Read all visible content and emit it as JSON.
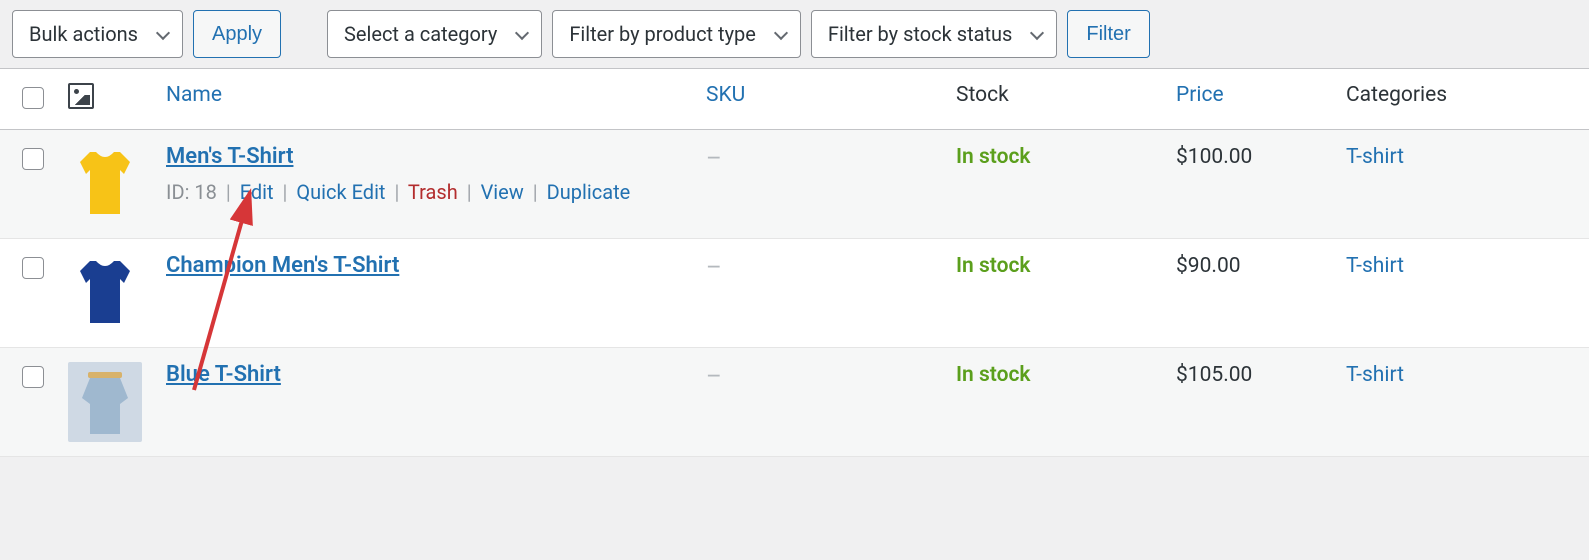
{
  "toolbar": {
    "bulk_label": "Bulk actions",
    "apply_label": "Apply",
    "category_label": "Select a category",
    "type_label": "Filter by product type",
    "stock_label": "Filter by stock status",
    "filter_label": "Filter"
  },
  "columns": {
    "name": "Name",
    "sku": "SKU",
    "stock": "Stock",
    "price": "Price",
    "categories": "Categories"
  },
  "products": [
    {
      "id_label": "ID: 18",
      "title": "Men's T-Shirt",
      "sku": "–",
      "stock": "In stock",
      "price": "$100.00",
      "category": "T-shirt",
      "show_row_actions": true,
      "thumb_color": "#f7c317",
      "thumb_type": "tshirt"
    },
    {
      "title": "Champion Men's T-Shirt",
      "sku": "–",
      "stock": "In stock",
      "price": "$90.00",
      "category": "T-shirt",
      "show_row_actions": false,
      "thumb_color": "#1a3e91",
      "thumb_type": "tshirt"
    },
    {
      "title": "Blue T-Shirt",
      "sku": "–",
      "stock": "In stock",
      "price": "$105.00",
      "category": "T-shirt",
      "show_row_actions": false,
      "thumb_color": "#9fb8cf",
      "thumb_type": "hanger"
    }
  ],
  "row_actions": {
    "edit": "Edit",
    "quick_edit": "Quick Edit",
    "trash": "Trash",
    "view": "View",
    "duplicate": "Duplicate"
  }
}
